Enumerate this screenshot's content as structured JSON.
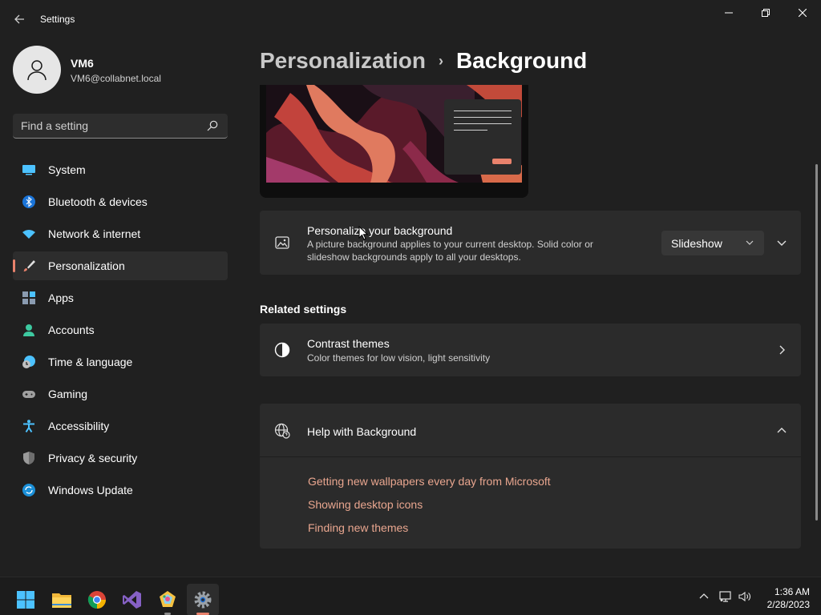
{
  "app": {
    "title": "Settings"
  },
  "window_controls": {
    "minimize_icon": "minimize-icon",
    "maximize_icon": "restore-icon",
    "close_icon": "close-icon"
  },
  "profile": {
    "name": "VM6",
    "email": "VM6@collabnet.local"
  },
  "search": {
    "placeholder": "Find a setting"
  },
  "nav": [
    {
      "label": "System",
      "icon": "monitor-icon",
      "active": false
    },
    {
      "label": "Bluetooth & devices",
      "icon": "bluetooth-icon",
      "active": false
    },
    {
      "label": "Network & internet",
      "icon": "wifi-icon",
      "active": false
    },
    {
      "label": "Personalization",
      "icon": "brush-icon",
      "active": true
    },
    {
      "label": "Apps",
      "icon": "apps-icon",
      "active": false
    },
    {
      "label": "Accounts",
      "icon": "person-icon",
      "active": false
    },
    {
      "label": "Time & language",
      "icon": "clock-globe-icon",
      "active": false
    },
    {
      "label": "Gaming",
      "icon": "gamepad-icon",
      "active": false
    },
    {
      "label": "Accessibility",
      "icon": "accessibility-icon",
      "active": false
    },
    {
      "label": "Privacy & security",
      "icon": "shield-icon",
      "active": false
    },
    {
      "label": "Windows Update",
      "icon": "update-icon",
      "active": false
    }
  ],
  "breadcrumb": {
    "parent": "Personalization",
    "separator": "›",
    "current": "Background"
  },
  "personalize_card": {
    "title": "Personalize your background",
    "description_line1": "A picture background applies to your current desktop. Solid color or",
    "description_line2": "slideshow backgrounds apply to all your desktops.",
    "dropdown_value": "Slideshow"
  },
  "related": {
    "heading": "Related settings",
    "contrast_title": "Contrast themes",
    "contrast_desc": "Color themes for low vision, light sensitivity"
  },
  "help": {
    "title": "Help with Background",
    "links": [
      "Getting new wallpapers every day from Microsoft",
      "Showing desktop icons",
      "Finding new themes"
    ]
  },
  "taskbar": {
    "apps": [
      "start-icon",
      "file-explorer-icon",
      "chrome-icon",
      "visual-studio-icon",
      "paint-icon",
      "settings-icon"
    ],
    "time": "1:36 AM",
    "date": "2/28/2023"
  },
  "colors": {
    "accent": "#e9826c",
    "link": "#e9a68f",
    "card": "#2b2b2b",
    "background": "#202020"
  }
}
